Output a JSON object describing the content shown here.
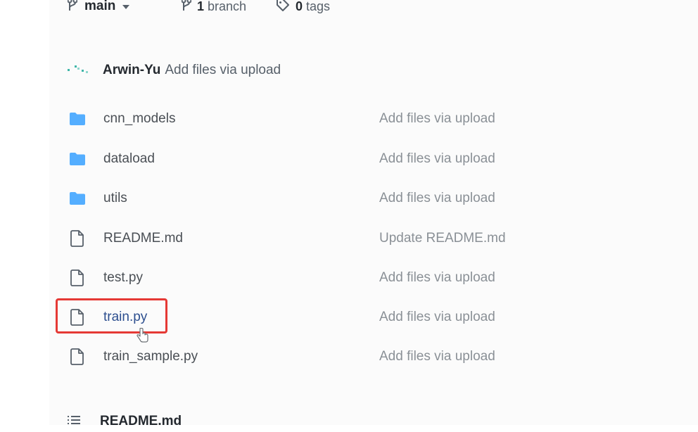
{
  "header": {
    "branch_name": "main",
    "branch_count": "1",
    "branch_word": "branch",
    "tag_count": "0",
    "tag_word": "tags"
  },
  "commit": {
    "author": "Arwin-Yu",
    "message": "Add files via upload"
  },
  "files": [
    {
      "name": "cnn_models",
      "type": "folder",
      "commit": "Add files via upload"
    },
    {
      "name": "dataload",
      "type": "folder",
      "commit": "Add files via upload"
    },
    {
      "name": "utils",
      "type": "folder",
      "commit": "Add files via upload"
    },
    {
      "name": "README.md",
      "type": "file",
      "commit": "Update README.md"
    },
    {
      "name": "test.py",
      "type": "file",
      "commit": "Add files via upload"
    },
    {
      "name": "train.py",
      "type": "file",
      "commit": "Add files via upload"
    },
    {
      "name": "train_sample.py",
      "type": "file",
      "commit": "Add files via upload"
    }
  ],
  "readme": {
    "title": "README.md"
  },
  "colors": {
    "folder": "#54aeff",
    "highlight": "#e53935",
    "link": "#2d4f8f"
  }
}
